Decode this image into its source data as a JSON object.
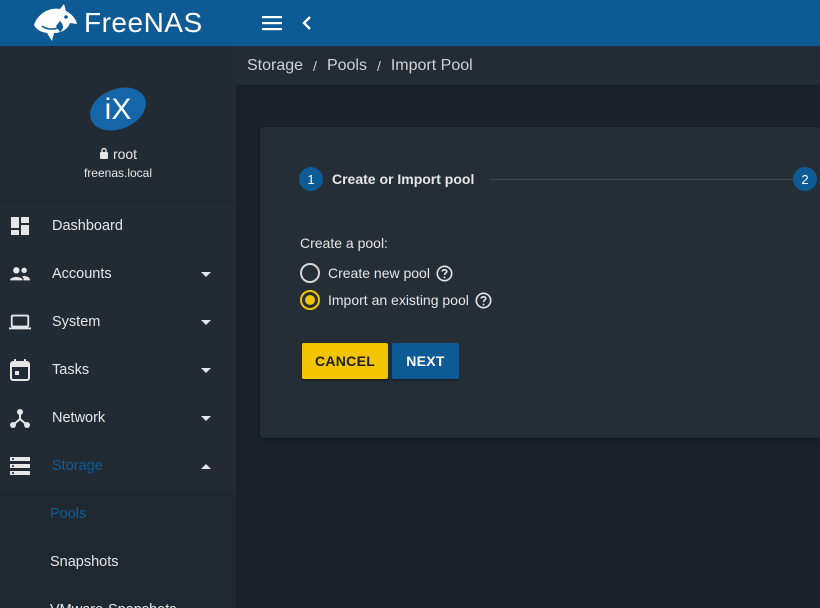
{
  "app": {
    "name": "FreeNAS",
    "trademark": "®",
    "tm_suffix": "™"
  },
  "profile": {
    "logo_text": "iX",
    "user": "root",
    "host": "freenas.local"
  },
  "sidebar": {
    "items": [
      {
        "label": "Dashboard",
        "icon": "dashboard-icon",
        "expandable": false
      },
      {
        "label": "Accounts",
        "icon": "people-icon",
        "expandable": true
      },
      {
        "label": "System",
        "icon": "laptop-icon",
        "expandable": true
      },
      {
        "label": "Tasks",
        "icon": "calendar-icon",
        "expandable": true
      },
      {
        "label": "Network",
        "icon": "network-icon",
        "expandable": true
      },
      {
        "label": "Storage",
        "icon": "storage-icon",
        "expandable": true,
        "expanded": true,
        "active": true
      }
    ],
    "storage_sub": [
      {
        "label": "Pools",
        "active": true
      },
      {
        "label": "Snapshots",
        "active": false
      },
      {
        "label": "VMware-Snapshots",
        "active": false
      }
    ]
  },
  "breadcrumb": {
    "items": [
      "Storage",
      "Pools",
      "Import Pool"
    ],
    "separator": "/"
  },
  "stepper": {
    "steps": [
      {
        "number": "1",
        "label": "Create or Import pool"
      },
      {
        "number": "2",
        "label": ""
      }
    ]
  },
  "form": {
    "label": "Create a pool:",
    "options": [
      {
        "label": "Create new pool",
        "checked": false
      },
      {
        "label": "Import an existing pool",
        "checked": true
      }
    ]
  },
  "buttons": {
    "cancel": "CANCEL",
    "next": "NEXT"
  },
  "colors": {
    "brand_blue": "#0d5a94",
    "accent_yellow": "#f2c500",
    "sidebar_bg": "#222b34",
    "content_bg": "#1b2129",
    "card_bg": "#252e37"
  }
}
